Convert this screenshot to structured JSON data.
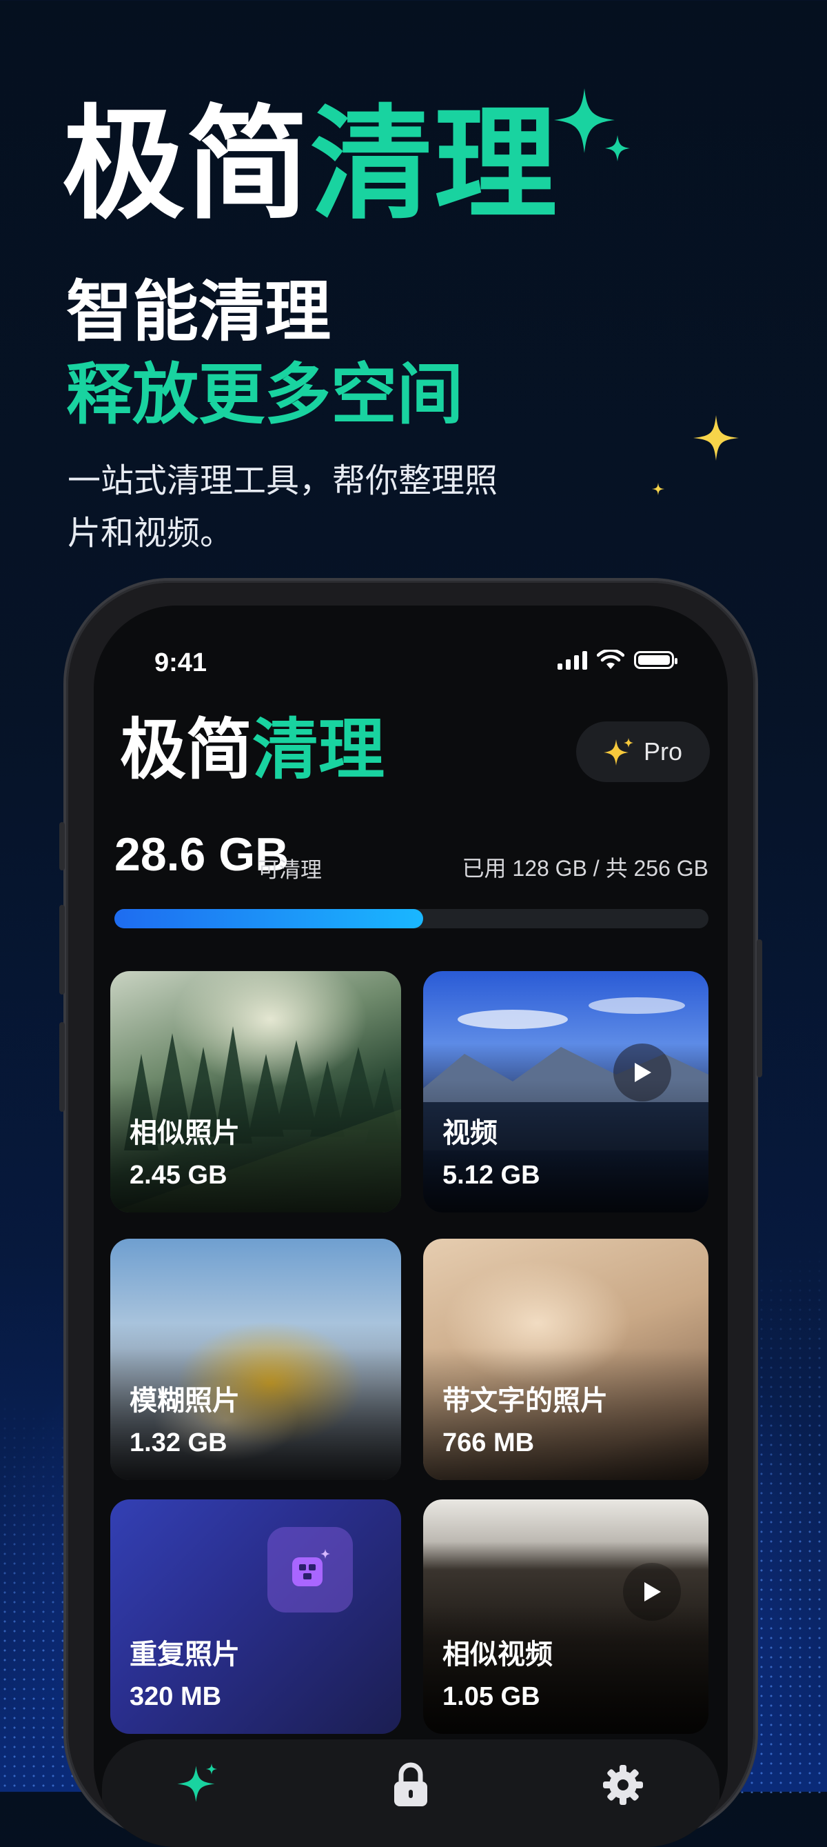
{
  "hero": {
    "title_white": "极简",
    "title_green": "清理",
    "subtitle_line1": "智能清理",
    "subtitle_line2": "释放更多空间",
    "description": "一站式清理工具，帮你整理照片和视频。"
  },
  "status_bar": {
    "time": "9:41"
  },
  "app": {
    "title_white": "极简",
    "title_green": "清理",
    "pro_label": "Pro"
  },
  "storage": {
    "cleanable": "28.6 GB",
    "cleanable_label": "可清理",
    "usage": "已用 128 GB / 共 256 GB",
    "progress_fraction": 0.52
  },
  "cards": [
    {
      "name": "相似照片",
      "size": "2.45 GB"
    },
    {
      "name": "视频",
      "size": "5.12 GB"
    },
    {
      "name": "模糊照片",
      "size": "1.32 GB"
    },
    {
      "name": "带文字的照片",
      "size": "766 MB"
    },
    {
      "name": "重复照片",
      "size": "320 MB"
    },
    {
      "name": "相似视频",
      "size": "1.05 GB"
    }
  ],
  "tabs": [
    {
      "icon": "sparkle-icon"
    },
    {
      "icon": "lock-icon"
    },
    {
      "icon": "gear-icon"
    }
  ],
  "colors": {
    "accent_green": "#19d3a0",
    "progress_blue": "#1e6cf0",
    "background": "#05101f"
  }
}
